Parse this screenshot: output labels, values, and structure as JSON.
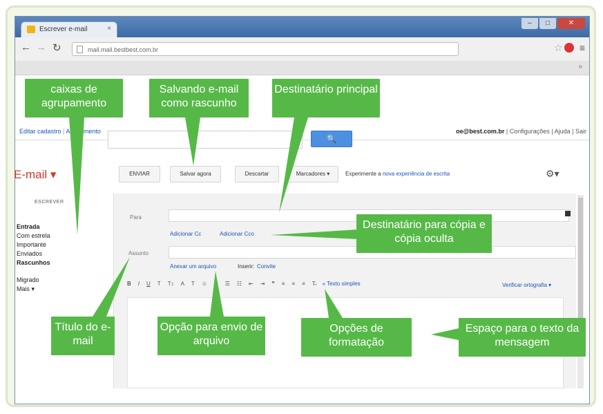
{
  "browser": {
    "tab_title": "Escrever e-mail",
    "url": "mail.mail.bestbest.com.br"
  },
  "gbar": {
    "left_links": [
      "Editar cadastro",
      "Atendimento"
    ],
    "email": "oe@best.com.br",
    "right_links": "| Configurações | Ajuda | Sair"
  },
  "app": {
    "title": "E-mail ▾",
    "search_button": "🔍",
    "toolbar": {
      "send": "ENVIAR",
      "save": "Salvar agora",
      "discard": "Descartar",
      "labels": "Marcadores ▾"
    },
    "promo_text": "Experimente a",
    "promo_link": "nova experiência de escrita",
    "gear": "⚙▾"
  },
  "sidebar": {
    "compose": "ESCREVER",
    "items": [
      "Entrada",
      "Com estrela",
      "Importante",
      "Enviados",
      "Rascunhos",
      "Migrado",
      "Mais ▾"
    ]
  },
  "composer": {
    "to_label": "Para",
    "cc_link": "Adicionar Cc",
    "bcc_link": "Adicionar Cco",
    "subject_label": "Assunto",
    "attach_link": "Anexar um arquivo",
    "insert_label": "Inserir:",
    "invite_link": "Convite",
    "format_tools": [
      "B",
      "I",
      "U",
      "T",
      "T↕",
      "A",
      "T",
      "☺",
      "∞",
      "☰",
      "☷",
      "⇤",
      "⇥",
      "❞",
      "≡",
      "≡",
      "≡",
      "T̶",
      "« Texto simples"
    ],
    "spell_link": "Verificar ortografia ▾"
  },
  "callouts": {
    "groupings": "caixas de agrupamento",
    "draft": "Salvando e-mail como rascunho",
    "recipient": "Destinatário principal",
    "cc_bcc": "Destinatário para cópia e cópia oculta",
    "subject": "Título do e-mail",
    "attach": "Opção para envio de arquivo",
    "format": "Opções de formatação",
    "message": "Espaço para o texto da mensagem"
  },
  "colors": {
    "callout_green": "#56b947",
    "frame_border": "#dde6c8",
    "title_red": "#cf3a2a",
    "search_blue": "#4d8fe0",
    "link_blue": "#1a55b5"
  }
}
